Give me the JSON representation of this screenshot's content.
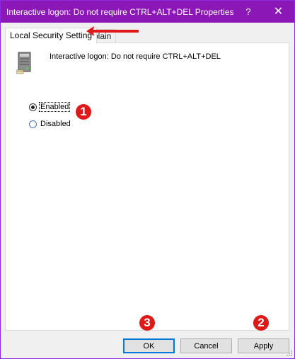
{
  "window": {
    "title": "Interactive logon: Do not require CTRL+ALT+DEL Properties",
    "help_glyph": "?",
    "close_glyph": "✕",
    "accent": "#8b17b6"
  },
  "tabs": [
    {
      "label": "Local Security Setting",
      "selected": true
    },
    {
      "label": "xplain",
      "selected": false
    }
  ],
  "policy": {
    "name": "Interactive logon: Do not require CTRL+ALT+DEL",
    "icon": "server-tower-icon"
  },
  "options": {
    "enabled": {
      "label": "Enabled",
      "selected": true
    },
    "disabled": {
      "label": "Disabled",
      "selected": false
    }
  },
  "buttons": {
    "ok": "OK",
    "cancel": "Cancel",
    "apply": "Apply"
  },
  "annotations": {
    "step1": "1",
    "step2": "2",
    "step3": "3",
    "color": "#e01818"
  }
}
